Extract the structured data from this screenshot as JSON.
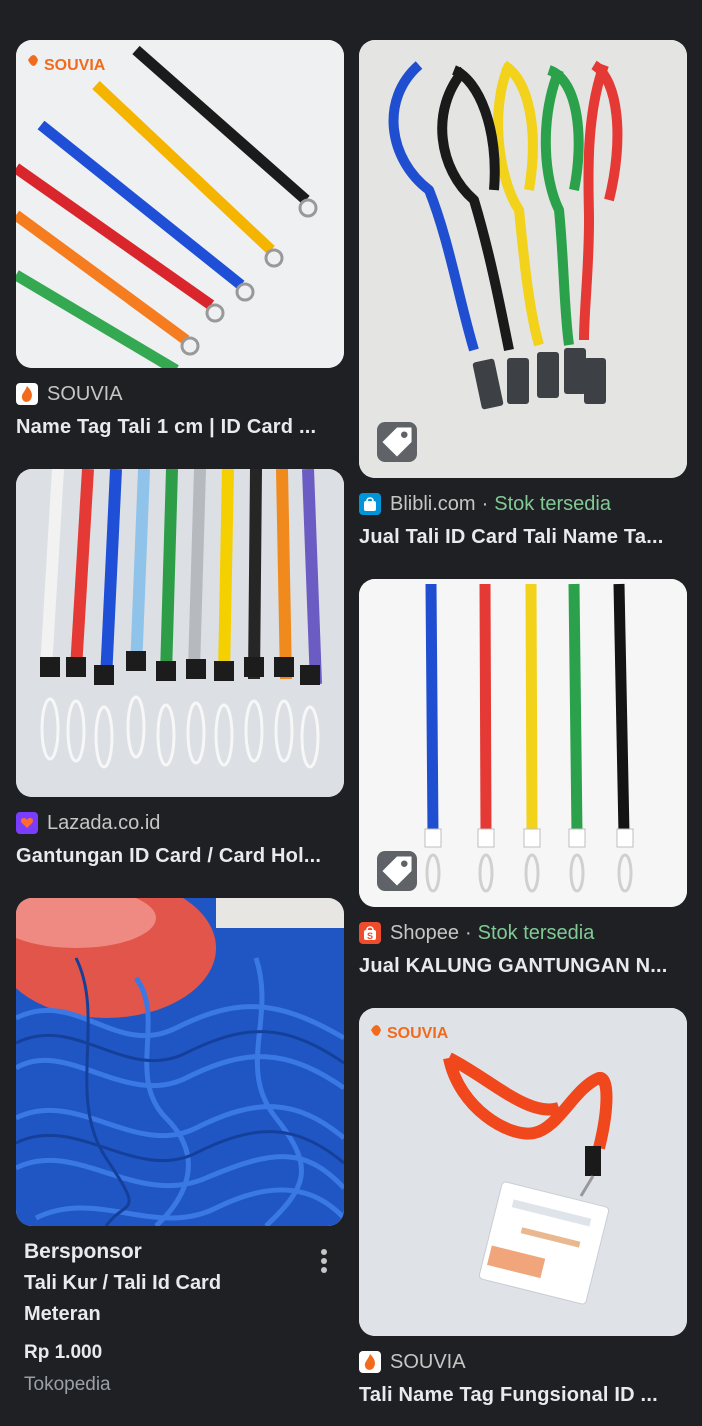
{
  "left_column": [
    {
      "source": "SOUVIA",
      "title": "Name Tag Tali 1 cm | ID Card ...",
      "favicon": "souvia-flame-icon",
      "image": "colorful-lanyards-with-clips"
    },
    {
      "source": "Lazada.co.id",
      "title": "Gantungan ID Card / Card Hol...",
      "favicon": "lazada-heart-icon",
      "image": "lanyards-hanging-row"
    },
    {
      "image": "blue-rope-pile",
      "sponsored": {
        "label": "Bersponsor",
        "title_line1": "Tali Kur / Tali Id Card",
        "title_line2": "Meteran",
        "price": "Rp 1.000",
        "merchant": "Tokopedia"
      }
    }
  ],
  "right_column": [
    {
      "source": "Blibli.com",
      "separator": "·",
      "stock": "Stok tersedia",
      "title": "Jual Tali ID Card Tali Name Ta...",
      "favicon": "blibli-bag-icon",
      "image": "five-lanyards-with-clips",
      "badge": "shopping-tag-icon"
    },
    {
      "source": "Shopee",
      "separator": "·",
      "stock": "Stok tersedia",
      "title": "Jual KALUNG GANTUNGAN N...",
      "favicon": "shopee-bag-icon",
      "image": "five-straight-lanyards",
      "badge": "shopping-tag-icon"
    },
    {
      "source": "SOUVIA",
      "title": "Tali Name Tag Fungsional ID ...",
      "favicon": "souvia-flame-icon",
      "image": "orange-lanyard-with-card"
    }
  ],
  "colors": {
    "background": "#1f2023",
    "stock_green": "#81c995",
    "text": "#e8eaed",
    "muted": "#c4c7c5"
  }
}
